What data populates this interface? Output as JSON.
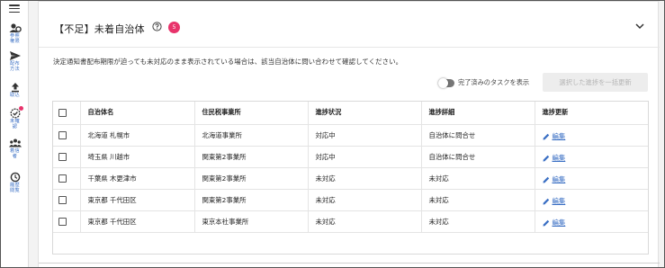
{
  "sidebar": {
    "items": [
      {
        "label": "参照\n権限",
        "icon": "gear-user-icon"
      },
      {
        "label": "配布\n方法",
        "icon": "send-icon"
      },
      {
        "label": "取込",
        "icon": "upload-icon"
      },
      {
        "label": "未確\n認",
        "icon": "check-circle-icon"
      },
      {
        "label": "着信\n者",
        "icon": "people-icon"
      },
      {
        "label": "履歴\n閲覧",
        "icon": "history-icon"
      }
    ]
  },
  "header": {
    "title": "【不足】未着自治体",
    "count": "5"
  },
  "notice": "決定通知書配布期限が迫っても未対応のまま表示されている場合は、該当自治体に問い合わせて確認してください。",
  "toggle": {
    "label": "完了済みのタスクを表示"
  },
  "bulk_button": {
    "label": "選択した進捗を一括更新"
  },
  "table": {
    "columns": [
      "自治体名",
      "住民税事業所",
      "進捗状況",
      "進捗詳細",
      "進捗更新"
    ],
    "rows": [
      {
        "name": "北海道 札幌市",
        "office": "北海道事業所",
        "status": "対応中",
        "detail": "自治体に問合せ",
        "action": "編集"
      },
      {
        "name": "埼玉県 川越市",
        "office": "関東第2事業所",
        "status": "対応中",
        "detail": "自治体に問合せ",
        "action": "編集"
      },
      {
        "name": "千葉県 木更津市",
        "office": "関東第2事業所",
        "status": "未対応",
        "detail": "未対応",
        "action": "編集"
      },
      {
        "name": "東京都 千代田区",
        "office": "関東第2事業所",
        "status": "未対応",
        "detail": "未対応",
        "action": "編集"
      },
      {
        "name": "東京都 千代田区",
        "office": "東京本社事業所",
        "status": "未対応",
        "detail": "未対応",
        "action": "編集"
      }
    ]
  },
  "colors": {
    "accent": "#3a6fc4",
    "badge": "#e8336b"
  }
}
